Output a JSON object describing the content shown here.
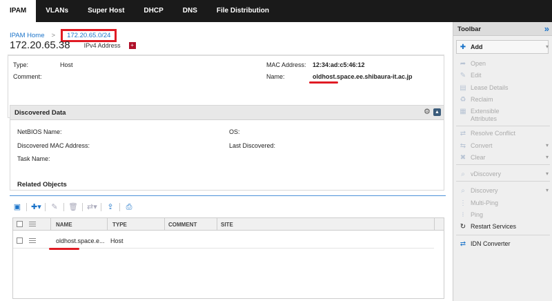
{
  "nav": {
    "tabs": [
      {
        "label": "IPAM",
        "active": true
      },
      {
        "label": "VLANs"
      },
      {
        "label": "Super Host"
      },
      {
        "label": "DHCP"
      },
      {
        "label": "DNS"
      },
      {
        "label": "File Distribution"
      }
    ]
  },
  "breadcrumb": {
    "home": "IPAM Home",
    "sep": ">",
    "network": "172.20.65.0/24"
  },
  "header": {
    "ip": "172.20.65.38",
    "type": "IPv4 Address"
  },
  "props": {
    "type_label": "Type:",
    "type_value": "Host",
    "comment_label": "Comment:",
    "mac_label": "MAC Address:",
    "mac_value": "12:34:ad:c5:46:12",
    "name_label": "Name:",
    "name_value": "oldhost.space.ee.shibaura-it.ac.jp"
  },
  "discovered": {
    "title": "Discovered Data",
    "netbios": "NetBIOS Name:",
    "os": "OS:",
    "mac": "Discovered MAC Address:",
    "last": "Last Discovered:",
    "task": "Task Name:"
  },
  "related": {
    "title": "Related Objects",
    "columns": [
      "NAME",
      "TYPE",
      "COMMENT",
      "SITE"
    ],
    "rows": [
      {
        "name": "oldhost.space.e...",
        "type": "Host"
      }
    ]
  },
  "toolbar": {
    "title": "Toolbar",
    "items": [
      {
        "label": "Add",
        "state": "enabled",
        "icon": "plus-icon",
        "dropdown": true
      },
      {
        "label": "Open",
        "state": "disabled",
        "icon": "open-icon"
      },
      {
        "label": "Edit",
        "state": "disabled",
        "icon": "edit-icon"
      },
      {
        "label": "Lease Details",
        "state": "disabled",
        "icon": "lease-icon"
      },
      {
        "label": "Reclaim",
        "state": "disabled",
        "icon": "recycle-icon"
      },
      {
        "label": "Extensible Attributes",
        "state": "disabled",
        "icon": "attributes-icon"
      },
      {
        "label": "Resolve Conflict",
        "state": "disabled",
        "icon": "conflict-icon"
      },
      {
        "label": "Convert",
        "state": "disabled",
        "icon": "convert-icon",
        "dropdown": true
      },
      {
        "label": "Clear",
        "state": "disabled",
        "icon": "clear-icon",
        "dropdown": true
      },
      {
        "label": "vDiscovery",
        "state": "disabled",
        "icon": "vdiscovery-icon",
        "dropdown": true
      },
      {
        "label": "Discovery",
        "state": "disabled",
        "icon": "discovery-icon",
        "dropdown": true
      },
      {
        "label": "Multi-Ping",
        "state": "disabled",
        "icon": "multiping-icon"
      },
      {
        "label": "Ping",
        "state": "disabled",
        "icon": "ping-icon"
      },
      {
        "label": "Restart Services",
        "state": "enabled",
        "icon": "restart-icon"
      },
      {
        "label": "IDN Converter",
        "state": "enabled",
        "icon": "idn-icon"
      }
    ]
  }
}
